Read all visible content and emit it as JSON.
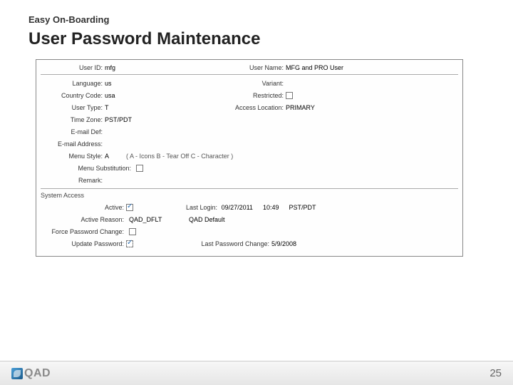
{
  "header": {
    "subtitle": "Easy On-Boarding",
    "title": "User Password Maintenance"
  },
  "form": {
    "top": {
      "userid_label": "User ID:",
      "userid_value": "mfg",
      "username_label": "User Name:",
      "username_value": "MFG and PRO User"
    },
    "left": {
      "language_label": "Language:",
      "language_value": "us",
      "country_label": "Country Code:",
      "country_value": "usa",
      "usertype_label": "User Type:",
      "usertype_value": "T",
      "timezone_label": "Time Zone:",
      "timezone_value": "PST/PDT",
      "emaildef_label": "E-mail Def:",
      "emailaddr_label": "E-mail Address:",
      "menustyle_label": "Menu Style:",
      "menustyle_value": "A",
      "menustyle_hint": "( A - Icons   B - Tear Off   C - Character )",
      "menusub_label": "Menu Substitution:",
      "remark_label": "Remark:"
    },
    "right": {
      "variant_label": "Variant:",
      "restricted_label": "Restricted:",
      "accessloc_label": "Access Location:",
      "accessloc_value": "PRIMARY"
    },
    "section": "System Access",
    "access": {
      "active_label": "Active:",
      "active_reason_label": "Active Reason:",
      "active_reason_value": "QAD_DFLT",
      "active_reason_desc": "QAD Default",
      "force_label": "Force Password Change:",
      "update_label": "Update Password:",
      "lastlogin_label": "Last Login:",
      "lastlogin_date": "09/27/2011",
      "lastlogin_time": "10:49",
      "lastlogin_tz": "PST/PDT",
      "lastchange_label": "Last Password Change:",
      "lastchange_value": "5/9/2008"
    }
  },
  "footer": {
    "brand": "QAD",
    "page": "25"
  }
}
